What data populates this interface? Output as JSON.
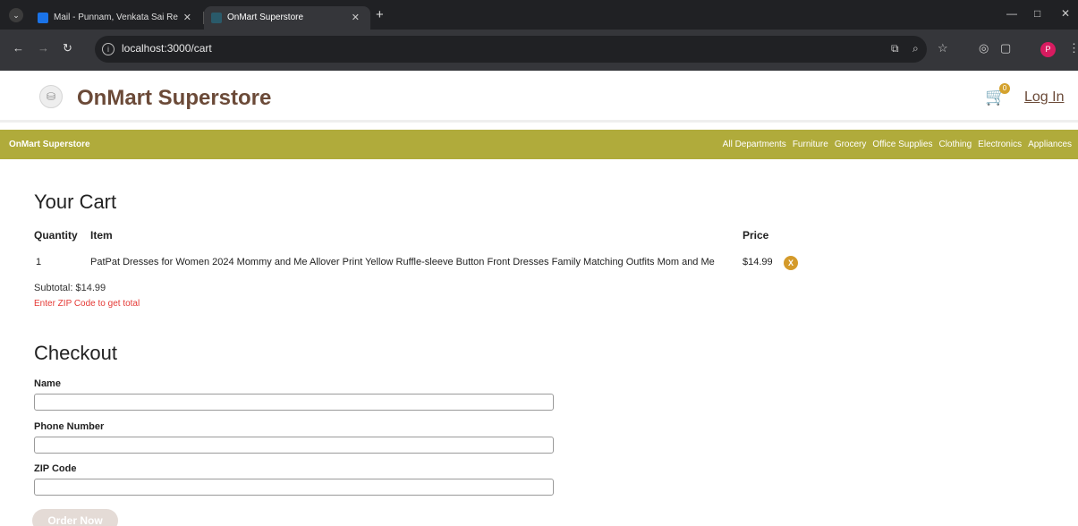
{
  "browser": {
    "tabs": [
      {
        "title": "Mail - Punnam, Venkata Sai Re"
      },
      {
        "title": "OnMart Superstore"
      }
    ],
    "url": "localhost:3000/cart",
    "profile_initial": "P"
  },
  "header": {
    "brand": "OnMart Superstore",
    "cart_count": "0",
    "login_label": "Log In"
  },
  "nav": {
    "brand": "OnMart Superstore",
    "links": [
      "All Departments",
      "Furniture",
      "Grocery",
      "Office Supplies",
      "Clothing",
      "Electronics",
      "Appliances"
    ]
  },
  "cart": {
    "title": "Your Cart",
    "columns": {
      "quantity": "Quantity",
      "item": "Item",
      "price": "Price"
    },
    "rows": [
      {
        "quantity": "1",
        "item": "PatPat Dresses for Women 2024 Mommy and Me Allover Print Yellow Ruffle-sleeve Button Front Dresses Family Matching Outfits Mom and Me",
        "price": "$14.99",
        "remove_label": "X"
      }
    ],
    "subtotal": "Subtotal: $14.99",
    "zip_note": "Enter ZIP Code to get total"
  },
  "checkout": {
    "title": "Checkout",
    "fields": [
      {
        "label": "Name",
        "value": ""
      },
      {
        "label": "Phone Number",
        "value": ""
      },
      {
        "label": "ZIP Code",
        "value": ""
      }
    ],
    "submit_label": "Order Now"
  },
  "colors": {
    "brand": "#6b4a38",
    "navbar": "#b0ab3b",
    "accent": "#d49a2a",
    "error": "#e53935"
  }
}
